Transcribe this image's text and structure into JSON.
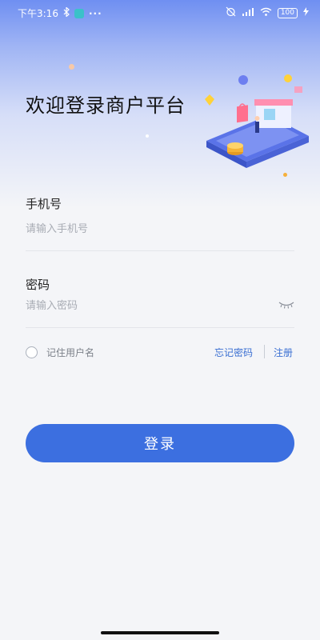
{
  "status_bar": {
    "time": "下午3:16",
    "bluetooth_icon": "bluetooth-icon",
    "app_icon": "shield-app-icon",
    "more": "···",
    "battery_level": "100"
  },
  "header": {
    "welcome_text": "欢迎登录商户平台"
  },
  "form": {
    "phone_label": "手机号",
    "phone_placeholder": "请输入手机号",
    "password_label": "密码",
    "password_placeholder": "请输入密码",
    "remember_label": "记住用户名",
    "forgot_link": "忘记密码",
    "register_link": "注册",
    "login_button": "登录"
  },
  "colors": {
    "primary": "#3c6fe0",
    "link": "#3a6fd2",
    "hero_top": "#6f8ff2"
  }
}
